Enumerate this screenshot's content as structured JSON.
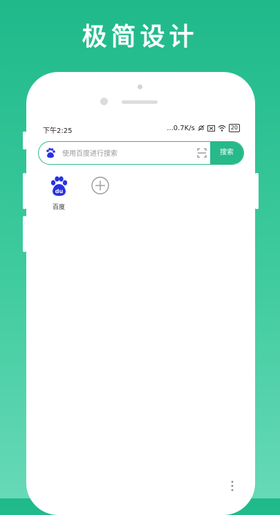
{
  "headline": "极简设计",
  "status_bar": {
    "time": "下午2:25",
    "network_speed": "...0.7K/s",
    "battery": "20"
  },
  "search": {
    "placeholder": "使用百度进行搜索",
    "button_label": "搜索"
  },
  "shortcuts": [
    {
      "label": "百度",
      "icon": "baidu-logo"
    },
    {
      "label": "",
      "icon": "add-icon"
    }
  ],
  "colors": {
    "accent": "#26b98a",
    "baidu_blue": "#2932e1"
  }
}
